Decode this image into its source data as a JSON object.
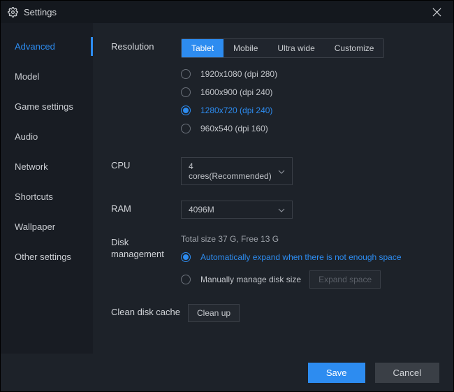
{
  "window": {
    "title": "Settings"
  },
  "sidebar": {
    "items": [
      {
        "label": "Advanced"
      },
      {
        "label": "Model"
      },
      {
        "label": "Game settings"
      },
      {
        "label": "Audio"
      },
      {
        "label": "Network"
      },
      {
        "label": "Shortcuts"
      },
      {
        "label": "Wallpaper"
      },
      {
        "label": "Other settings"
      }
    ]
  },
  "resolution": {
    "label": "Resolution",
    "tabs": {
      "tablet": "Tablet",
      "mobile": "Mobile",
      "ultrawide": "Ultra wide",
      "customize": "Customize"
    },
    "options": [
      "1920x1080  (dpi 280)",
      "1600x900  (dpi 240)",
      "1280x720  (dpi 240)",
      "960x540  (dpi 160)"
    ]
  },
  "cpu": {
    "label": "CPU",
    "value": "4 cores(Recommended)"
  },
  "ram": {
    "label": "RAM",
    "value": "4096M"
  },
  "disk": {
    "label": "Disk management",
    "status": "Total size 37 G,  Free 13 G",
    "auto": "Automatically expand when there is not enough space",
    "manual": "Manually manage disk size",
    "expand": "Expand space"
  },
  "clean": {
    "label": "Clean disk cache",
    "button": "Clean up"
  },
  "footer": {
    "save": "Save",
    "cancel": "Cancel"
  }
}
